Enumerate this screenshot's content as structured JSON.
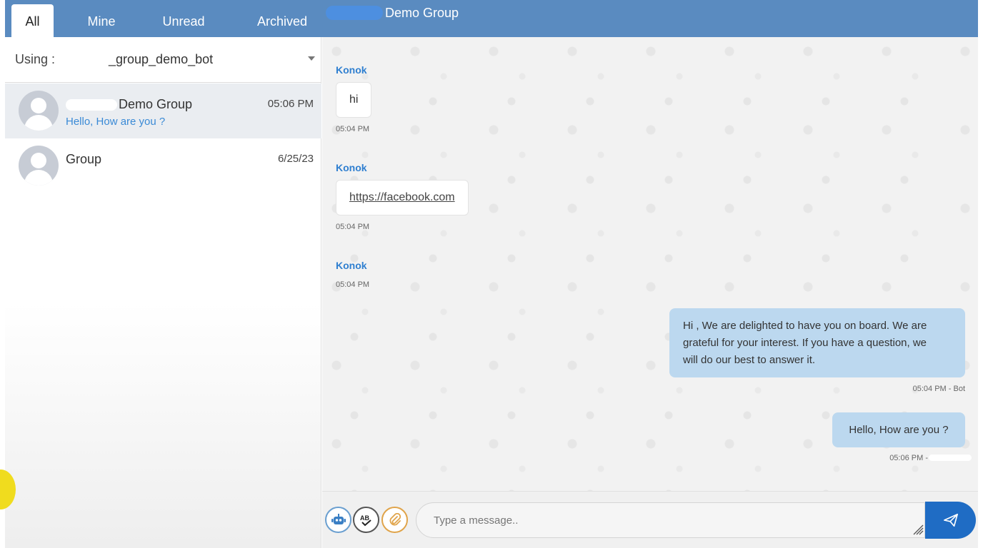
{
  "tabs": [
    {
      "label": "All",
      "active": true
    },
    {
      "label": "Mine",
      "active": false
    },
    {
      "label": "Unread",
      "active": false
    },
    {
      "label": "Archived",
      "active": false
    }
  ],
  "chat_header": {
    "title": "Demo Group"
  },
  "using": {
    "label": "Using :",
    "value": "_group_demo_bot"
  },
  "conversations": [
    {
      "name": "Demo Group",
      "time": "05:06 PM",
      "preview": "Hello, How are you ?",
      "selected": true
    },
    {
      "name": "Group",
      "time": "6/25/23",
      "preview": "",
      "selected": false
    }
  ],
  "messages": [
    {
      "sender": "Konok",
      "text": "hi",
      "time": "05:04 PM"
    },
    {
      "sender": "Konok",
      "link": "https://facebook.com",
      "time": "05:04 PM"
    },
    {
      "sender": "Konok",
      "time": "05:04 PM"
    },
    {
      "lines": [
        "Hi , We are delighted to have you on board. We are",
        "grateful for your interest. If you have a question, we",
        "will do our best to answer it."
      ],
      "time": "05:04 PM - Bot"
    },
    {
      "text": "Hello, How are you ?",
      "time": "05:06 PM -"
    }
  ],
  "composer": {
    "placeholder": "Type a message..",
    "bot_icon": "bot-icon",
    "spellcheck_icon": "spellcheck-icon",
    "attach_icon": "paperclip-icon",
    "send_icon": "send-icon"
  },
  "colors": {
    "accent": "#5a8bc0",
    "send": "#1f6cc4",
    "outgoing_bubble": "#bcd8ef",
    "sender_name": "#2f7fd0",
    "preview": "#3a8ad6"
  }
}
